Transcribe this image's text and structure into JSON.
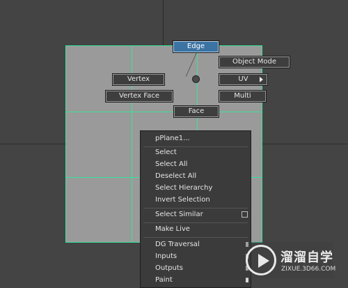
{
  "marking_menu": {
    "edge": "Edge",
    "object_mode": "Object Mode",
    "vertex": "Vertex",
    "uv": "UV",
    "vertex_face": "Vertex Face",
    "multi": "Multi",
    "face": "Face"
  },
  "context_menu": {
    "header": "pPlane1...",
    "items": [
      "Select",
      "Select All",
      "Deselect All",
      "Select Hierarchy",
      "Invert Selection",
      "Select Similar",
      "Make Live",
      "DG Traversal",
      "Inputs",
      "Outputs",
      "Paint"
    ]
  },
  "watermark": {
    "title": "溜溜自学",
    "url": "ZIXUE.3D66.COM"
  },
  "colors": {
    "viewport_bg": "#444444",
    "plane_fill": "#9a9a9a",
    "wireframe": "#37e39a",
    "active_button": "#3b73a3"
  }
}
